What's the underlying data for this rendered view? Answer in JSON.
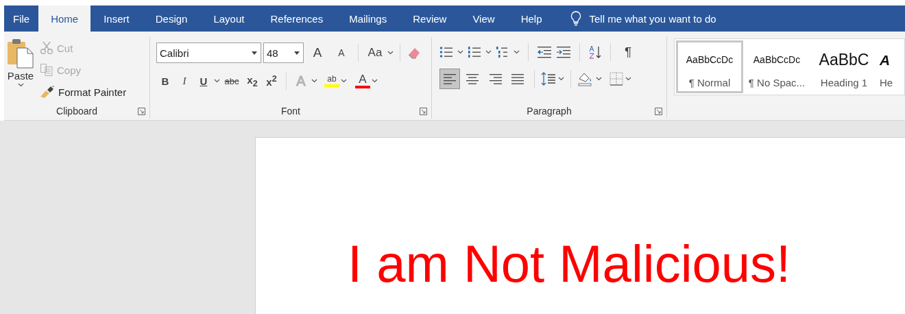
{
  "tabs": [
    {
      "label": "File",
      "selected": false
    },
    {
      "label": "Home",
      "selected": true
    },
    {
      "label": "Insert",
      "selected": false
    },
    {
      "label": "Design",
      "selected": false
    },
    {
      "label": "Layout",
      "selected": false
    },
    {
      "label": "References",
      "selected": false
    },
    {
      "label": "Mailings",
      "selected": false
    },
    {
      "label": "Review",
      "selected": false
    },
    {
      "label": "View",
      "selected": false
    },
    {
      "label": "Help",
      "selected": false
    }
  ],
  "tell_me": {
    "placeholder": "Tell me what you want to do"
  },
  "clipboard": {
    "paste": "Paste",
    "cut": {
      "label": "Cut",
      "disabled": true
    },
    "copy": {
      "label": "Copy",
      "disabled": true
    },
    "format_painter": {
      "label": "Format Painter",
      "disabled": false
    },
    "group_label": "Clipboard"
  },
  "font": {
    "name": "Calibri",
    "size": "48",
    "grow": "A",
    "shrink": "A",
    "change_case": "Aa",
    "bold": "B",
    "italic": "I",
    "underline": "U",
    "strikethrough": "abc",
    "subscript": "x$_{2}$",
    "superscript": "x$^{2}$",
    "text_effects": "A",
    "highlight": "ab",
    "font_color": "A",
    "group_label": "Font"
  },
  "paragraph": {
    "pilcrow": "¶",
    "alignment": [
      {
        "kind": "left",
        "selected": true
      },
      {
        "kind": "center",
        "selected": false
      },
      {
        "kind": "right",
        "selected": false
      },
      {
        "kind": "justify",
        "selected": false
      }
    ],
    "group_label": "Paragraph"
  },
  "styles": [
    {
      "kind": "body",
      "sample": "AaBbCcDc",
      "label": "¶ Normal",
      "selected": true
    },
    {
      "kind": "body",
      "sample": "AaBbCcDc",
      "label": "¶ No Spac...",
      "selected": false
    },
    {
      "kind": "heading1",
      "sample": "AaBbC",
      "label": "Heading 1",
      "selected": false
    },
    {
      "kind": "heading2",
      "sample": "A",
      "label": "He",
      "selected": false
    }
  ],
  "document": {
    "text": "I am Not Malicious!"
  }
}
